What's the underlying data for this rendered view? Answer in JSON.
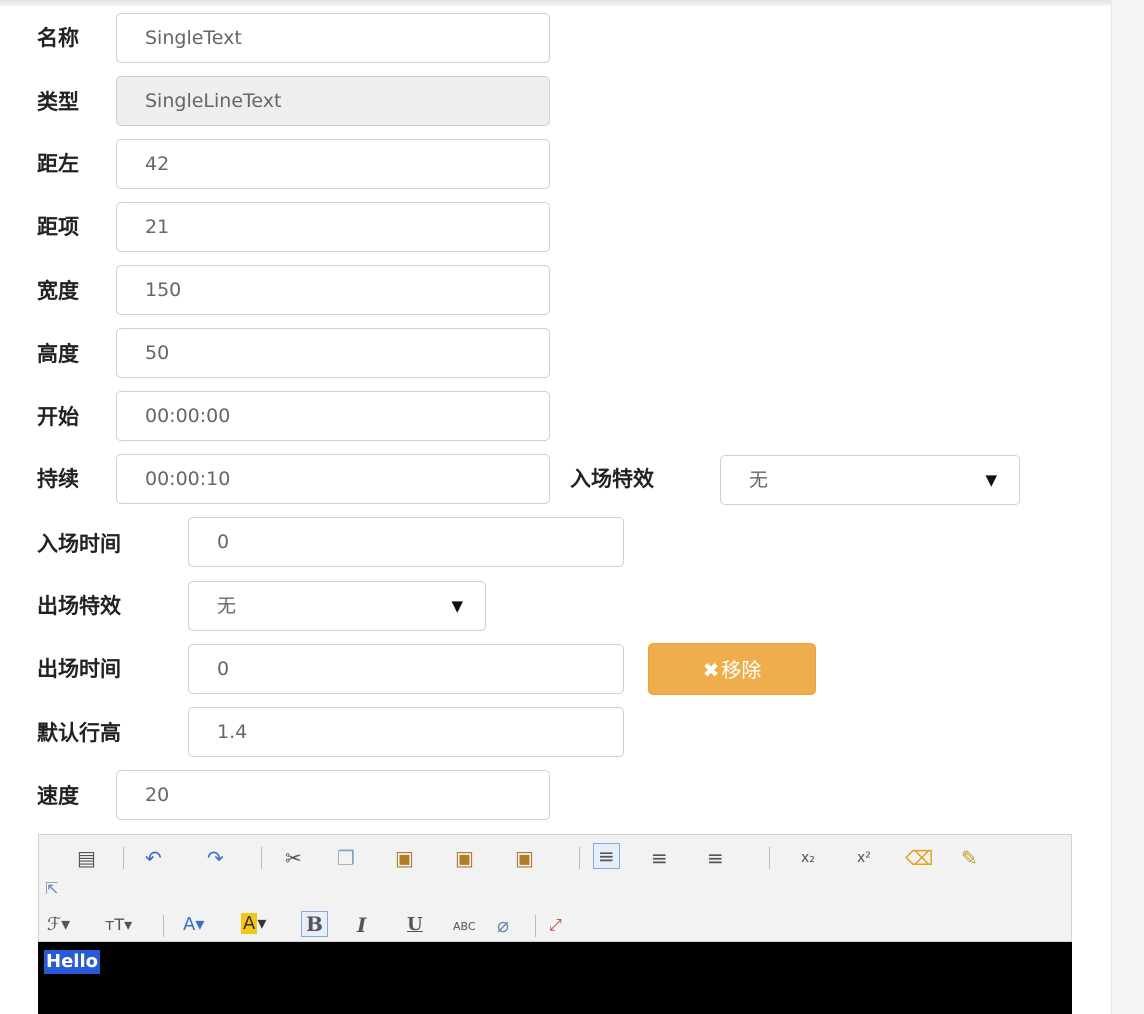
{
  "form": {
    "name": {
      "label": "名称",
      "value": "SingleText"
    },
    "type": {
      "label": "类型",
      "value": "SingleLineText"
    },
    "left": {
      "label": "距左",
      "value": "42"
    },
    "top": {
      "label": "距项",
      "value": "21"
    },
    "width": {
      "label": "宽度",
      "value": "150"
    },
    "height": {
      "label": "高度",
      "value": "50"
    },
    "start": {
      "label": "开始",
      "value": "00:00:00"
    },
    "duration": {
      "label": "持续",
      "value": "00:00:10"
    },
    "enter_effect": {
      "label": "入场特效",
      "value": "无"
    },
    "enter_time": {
      "label": "入场时间",
      "value": "0"
    },
    "exit_effect": {
      "label": "出场特效",
      "value": "无"
    },
    "exit_time": {
      "label": "出场时间",
      "value": "0"
    },
    "line_height": {
      "label": "默认行高",
      "value": "1.4"
    },
    "speed": {
      "label": "速度",
      "value": "20"
    },
    "remove_button": {
      "icon": "✖",
      "label": "移除"
    }
  },
  "editor": {
    "toolbar_row1": [
      "source-icon",
      "undo-icon",
      "redo-icon",
      "cut-icon",
      "copy-icon",
      "paste-icon",
      "paste-text-icon",
      "paste-word-icon",
      "align-left-icon",
      "align-center-icon",
      "align-right-icon",
      "subscript-icon",
      "superscript-icon",
      "clear-format-icon",
      "edit-icon",
      "select-icon"
    ],
    "toolbar_row2": [
      "font-family-icon",
      "font-size-icon",
      "font-color-icon",
      "background-color-icon",
      "bold-icon",
      "italic-icon",
      "underline-icon",
      "strikethrough-icon",
      "eraser-icon",
      "fullscreen-icon"
    ],
    "content_text": "Hello"
  },
  "colors": {
    "accent_warning": "#f0ad4e",
    "selection": "#2a5bd7",
    "editor_bg": "#000000"
  }
}
